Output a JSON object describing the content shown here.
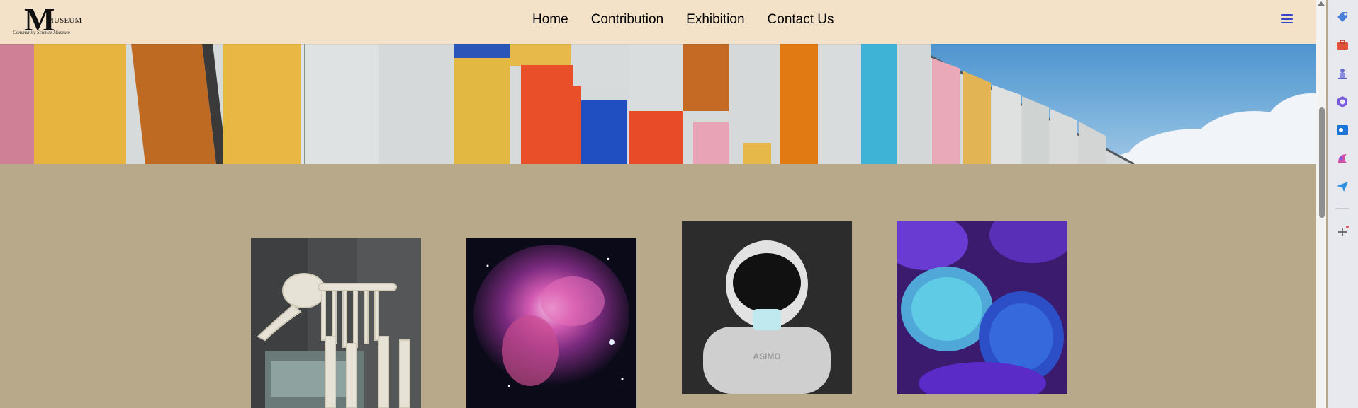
{
  "logo": {
    "letter": "M",
    "word": "MUSEUM",
    "tagline": "Community Science Museum"
  },
  "nav": {
    "items": [
      "Home",
      "Contribution",
      "Exhibition",
      "Contact Us"
    ]
  },
  "icons": {
    "menu": "hamburger-menu-icon"
  },
  "gallery": [
    {
      "name": "mammoth-skeleton-image"
    },
    {
      "name": "nebula-image"
    },
    {
      "name": "asimo-robot-image",
      "text": "ASIMO"
    },
    {
      "name": "coral-image"
    }
  ],
  "sidebar_icons": [
    "tag-icon",
    "briefcase-icon",
    "chess-icon",
    "copilot-icon",
    "outlook-icon",
    "designer-icon",
    "send-icon",
    "add-icon"
  ],
  "colors": {
    "navbar": "#f4e2c8",
    "page_bg": "#b8a98b",
    "menu_icon": "#3742c8"
  }
}
